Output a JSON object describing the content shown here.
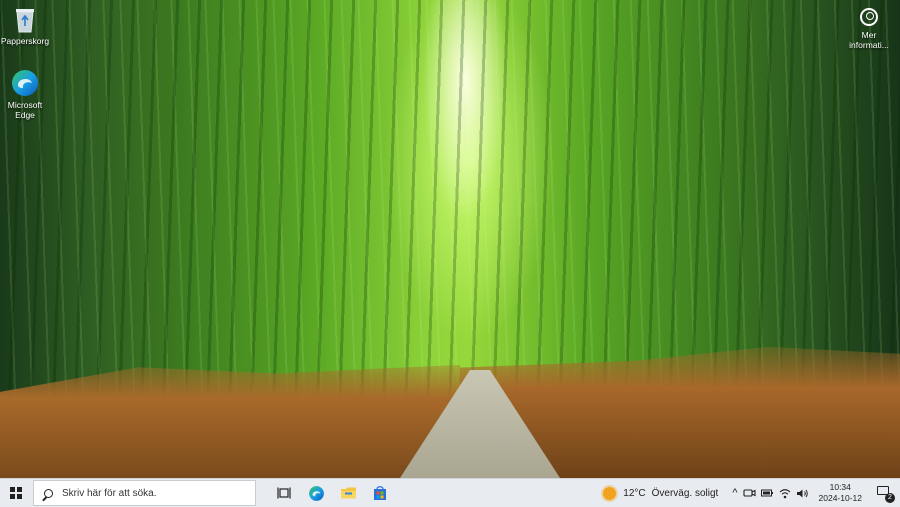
{
  "desktop": {
    "icons": [
      {
        "label": "Papperskorg",
        "icon": "recycle-bin-icon"
      },
      {
        "label": "Microsoft Edge",
        "icon": "edge-icon"
      }
    ],
    "info_button": {
      "label": "Mer informati...",
      "icon": "info-person-icon"
    }
  },
  "taskbar": {
    "start_icon": "windows-logo-icon",
    "search": {
      "placeholder": "Skriv här för att söka."
    },
    "apps": [
      {
        "name": "Aktivitetsvy",
        "icon": "task-view-icon"
      },
      {
        "name": "Microsoft Edge",
        "icon": "edge-icon"
      },
      {
        "name": "Utforskaren",
        "icon": "folder-icon"
      },
      {
        "name": "Microsoft Store",
        "icon": "store-icon"
      }
    ],
    "weather": {
      "temp": "12°C",
      "condition": "Överväg. soligt",
      "icon": "sun-icon"
    },
    "tray": {
      "chevron": "^",
      "icons": [
        "meet-now-icon",
        "battery-icon",
        "network-icon",
        "volume-icon"
      ]
    },
    "clock": {
      "time": "10:34",
      "date": "2024-10-12"
    },
    "notifications": {
      "count": "2"
    }
  },
  "colors": {
    "taskbar_bg": "#e8ecf0",
    "accent_blue": "#1a73e8",
    "weather_sun": "#f2a21e"
  }
}
